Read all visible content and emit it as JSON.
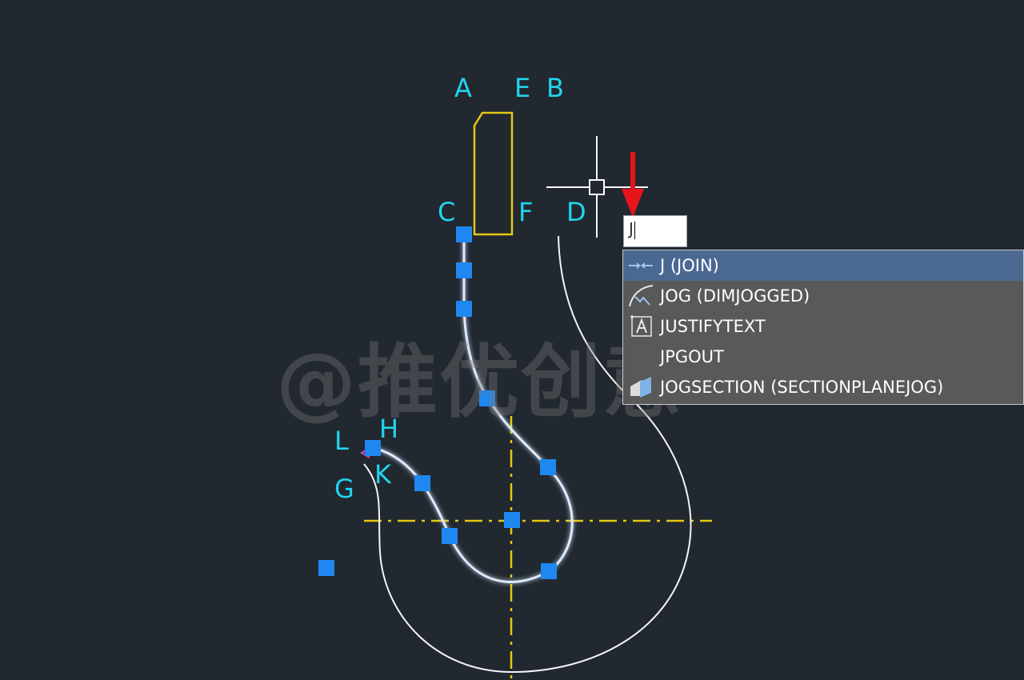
{
  "colors": {
    "background": "#212830",
    "point_labels": "#22d3ee",
    "grip": "#1e88f0",
    "selected_curve": "#dbeafe",
    "construction_line": "#e3c814",
    "curve": "#ffffff",
    "arrow": "#e8141b",
    "autocomplete_bg": "#595959",
    "autocomplete_selected": "#4b6893"
  },
  "point_labels": {
    "a": "A",
    "e": "E",
    "b": "B",
    "c": "C",
    "f": "F",
    "d": "D",
    "l": "L",
    "h": "H",
    "g": "G",
    "k": "K"
  },
  "watermark": "@推优创意",
  "command_line": {
    "input_value": "J"
  },
  "autocomplete": {
    "items": [
      {
        "label": "J (JOIN)",
        "icon": "join-icon",
        "selected": true
      },
      {
        "label": "JOG (DIMJOGGED)",
        "icon": "jogged-dimension-icon",
        "selected": false
      },
      {
        "label": "JUSTIFYTEXT",
        "icon": "justify-text-icon",
        "selected": false
      },
      {
        "label": "JPGOUT",
        "icon": "",
        "selected": false
      },
      {
        "label": "JOGSECTION (SECTIONPLANEJOG)",
        "icon": "section-plane-jog-icon",
        "selected": false
      }
    ]
  }
}
